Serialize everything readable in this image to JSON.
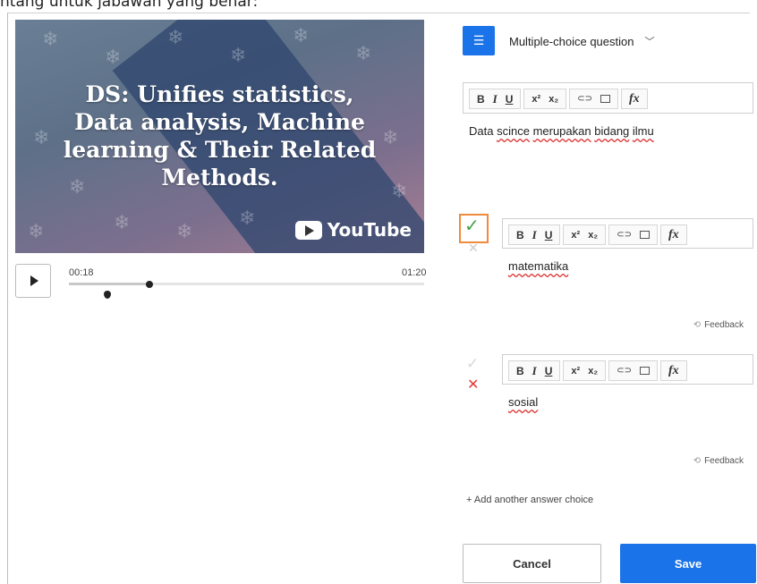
{
  "caption": "ntang untuk jabawan yang benar:",
  "video": {
    "title": "DS: Unifies statistics, Data analysis, Machine learning & Their Related Methods.",
    "youtube_label": "YouTube",
    "current_time": "00:18",
    "duration": "01:20",
    "progress": 0.225
  },
  "question": {
    "type_label": "Multiple-choice question",
    "text": "Data scince merupakan bidang ilmu"
  },
  "toolbar": {
    "bold": "B",
    "italic": "I",
    "underline": "U",
    "superscript": "x²",
    "subscript": "x₂",
    "fx": "fx"
  },
  "answers": [
    {
      "text": "matematika",
      "feedback_label": "Feedback",
      "correct": true
    },
    {
      "text": "sosial",
      "feedback_label": "Feedback",
      "correct": false
    }
  ],
  "add_choice_label": "+ Add another answer choice",
  "buttons": {
    "cancel": "Cancel",
    "save": "Save"
  },
  "colors": {
    "accent": "#1a73e8",
    "correct": "#43a047",
    "wrong": "#e53935",
    "focus": "#f08a3c"
  }
}
